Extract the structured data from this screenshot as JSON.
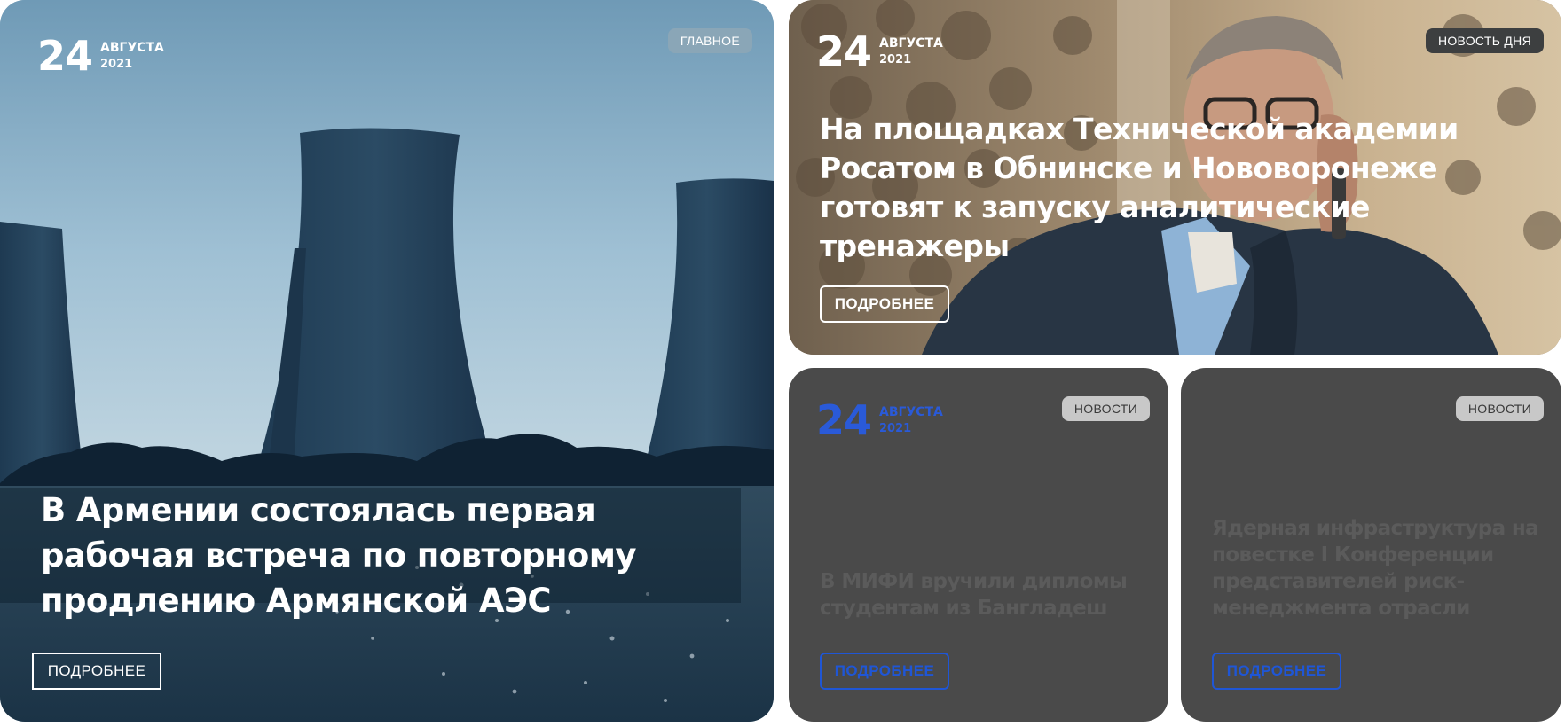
{
  "cards": {
    "main": {
      "date": {
        "day": "24",
        "month": "АВГУСТА",
        "year": "2021"
      },
      "badge": "ГЛАВНОЕ",
      "headline": "В Армении состоялась первая рабочая встреча по повторному продлению Армянской АЭС",
      "button": "ПОДРОБНЕЕ"
    },
    "day_news": {
      "date": {
        "day": "24",
        "month": "АВГУСТА",
        "year": "2021"
      },
      "badge": "НОВОСТЬ ДНЯ",
      "headline": "На площадках Технической академии Росатом в Обнинске и Нововоронеже готовят к запуску аналитические тренажеры",
      "button": "ПОДРОБНЕЕ"
    },
    "news_1": {
      "date": {
        "day": "24",
        "month": "АВГУСТА",
        "year": "2021"
      },
      "badge": "НОВОСТИ",
      "headline": "В МИФИ вручили дипломы студентам из Бангладеш",
      "button": "ПОДРОБНЕЕ"
    },
    "news_2": {
      "badge": "НОВОСТИ",
      "headline": "Ядерная инфраструктура на повестке I Конференции представителей риск-менеджмента отрасли",
      "button": "ПОДРОБНЕЕ"
    }
  },
  "colors": {
    "accent_blue": "#1f56d6",
    "date_blue": "#2a5ad8",
    "card_dark": "#4a4a4a",
    "badge_light": "#c8c8c8",
    "badge_dark": "#3d3f40",
    "muted_text": "#5b5b5b"
  }
}
